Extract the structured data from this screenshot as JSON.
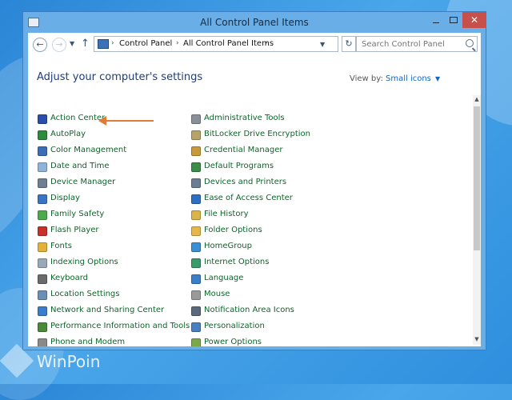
{
  "window": {
    "title": "All Control Panel Items"
  },
  "address": {
    "crumbs": [
      "Control Panel",
      "All Control Panel Items"
    ],
    "search_placeholder": "Search Control Panel"
  },
  "content": {
    "heading": "Adjust your computer's settings",
    "view_by_label": "View by:",
    "view_by_value": "Small icons"
  },
  "items_left": [
    {
      "label": "Action Center",
      "icon": "flag-icon",
      "color": "#2b4fa8"
    },
    {
      "label": "AutoPlay",
      "icon": "autoplay-icon",
      "color": "#2e8b3d"
    },
    {
      "label": "Color Management",
      "icon": "monitor-color-icon",
      "color": "#3a6fb8"
    },
    {
      "label": "Date and Time",
      "icon": "clock-icon",
      "color": "#8fb3d9"
    },
    {
      "label": "Device Manager",
      "icon": "device-manager-icon",
      "color": "#6f7f8f"
    },
    {
      "label": "Display",
      "icon": "display-icon",
      "color": "#3a75c4"
    },
    {
      "label": "Family Safety",
      "icon": "family-icon",
      "color": "#4caa4c"
    },
    {
      "label": "Flash Player",
      "icon": "flash-icon",
      "color": "#c8302a"
    },
    {
      "label": "Fonts",
      "icon": "fonts-folder-icon",
      "color": "#e3b23c"
    },
    {
      "label": "Indexing Options",
      "icon": "indexing-icon",
      "color": "#9aa9b8"
    },
    {
      "label": "Keyboard",
      "icon": "keyboard-icon",
      "color": "#6b6b6b"
    },
    {
      "label": "Location Settings",
      "icon": "location-icon",
      "color": "#6c8fb5"
    },
    {
      "label": "Network and Sharing Center",
      "icon": "network-icon",
      "color": "#3d7cc8"
    },
    {
      "label": "Performance Information and Tools",
      "icon": "performance-icon",
      "color": "#4a8a3a"
    },
    {
      "label": "Phone and Modem",
      "icon": "phone-icon",
      "color": "#8a8a8a"
    }
  ],
  "items_right": [
    {
      "label": "Administrative Tools",
      "icon": "admin-tools-icon",
      "color": "#8a8f98"
    },
    {
      "label": "BitLocker Drive Encryption",
      "icon": "bitlocker-icon",
      "color": "#b5a36a"
    },
    {
      "label": "Credential Manager",
      "icon": "credential-icon",
      "color": "#c99a3a"
    },
    {
      "label": "Default Programs",
      "icon": "default-programs-icon",
      "color": "#3c8c4a"
    },
    {
      "label": "Devices and Printers",
      "icon": "printer-icon",
      "color": "#6a7d92"
    },
    {
      "label": "Ease of Access Center",
      "icon": "ease-access-icon",
      "color": "#2f6fc0"
    },
    {
      "label": "File History",
      "icon": "file-history-icon",
      "color": "#d9b44a"
    },
    {
      "label": "Folder Options",
      "icon": "folder-icon",
      "color": "#e6b84a"
    },
    {
      "label": "HomeGroup",
      "icon": "homegroup-icon",
      "color": "#3d8fd4"
    },
    {
      "label": "Internet Options",
      "icon": "globe-icon",
      "color": "#3a9a6a"
    },
    {
      "label": "Language",
      "icon": "language-icon",
      "color": "#3a7fc8"
    },
    {
      "label": "Mouse",
      "icon": "mouse-icon",
      "color": "#9a9a9a"
    },
    {
      "label": "Notification Area Icons",
      "icon": "notification-icon",
      "color": "#5a6a7a"
    },
    {
      "label": "Personalization",
      "icon": "personalization-icon",
      "color": "#4a7fbf"
    },
    {
      "label": "Power Options",
      "icon": "power-icon",
      "color": "#7aa84a"
    }
  ],
  "watermark": {
    "text": "WinPoin"
  }
}
